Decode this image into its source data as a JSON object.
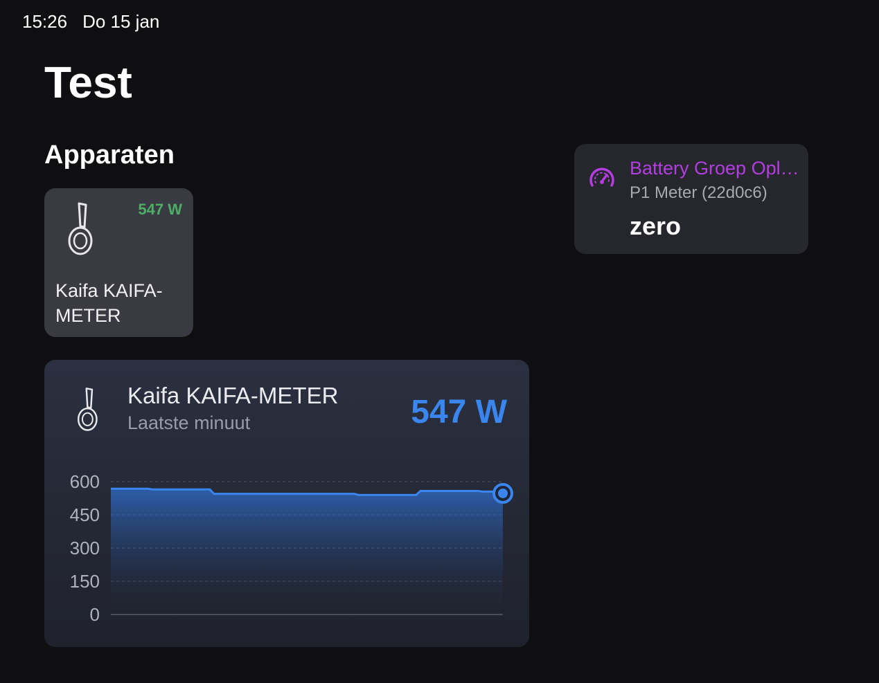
{
  "status": {
    "time": "15:26",
    "date": "Do 15 jan"
  },
  "page": {
    "title": "Test"
  },
  "section": {
    "title": "Apparaten"
  },
  "device_tile": {
    "value": "547 W",
    "name": "Kaifa KAIFA-METER",
    "icon": "meter-probe-icon",
    "value_color": "#4caf64"
  },
  "battery_card": {
    "title": "Battery Groep Opl…",
    "subtitle": "P1 Meter (22d0c6)",
    "value": "zero",
    "icon": "gauge-icon",
    "accent": "#b33ee0"
  },
  "chart_card": {
    "title": "Kaifa KAIFA-METER",
    "subtitle": "Laatste minuut",
    "value": "547 W",
    "icon": "meter-probe-icon",
    "accent": "#3a86ee"
  },
  "chart_data": {
    "type": "area",
    "ylim": [
      0,
      600
    ],
    "yticks": [
      "600",
      "450",
      "300",
      "150",
      "0"
    ],
    "grid": true,
    "series": [
      {
        "values": [
          568,
          568,
          565,
          565,
          565,
          545,
          545,
          545,
          545,
          545,
          545,
          545,
          540,
          540,
          540,
          558,
          558,
          558,
          555,
          547
        ]
      }
    ]
  }
}
